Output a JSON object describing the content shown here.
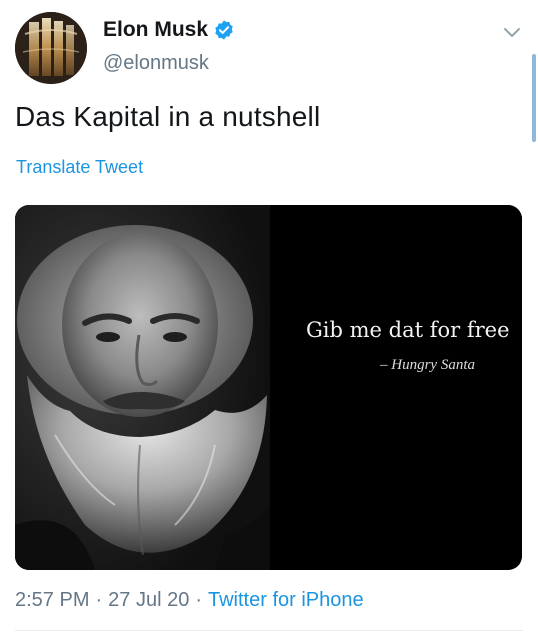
{
  "author": {
    "name": "Elon Musk",
    "handle": "@elonmusk",
    "verified": true,
    "avatar_icon": "profile-avatar"
  },
  "tweet": {
    "text": "Das Kapital in a nutshell",
    "translate_label": "Translate Tweet"
  },
  "media": {
    "quote": "Gib me dat for free",
    "attribution": "– Hungry Santa",
    "portrait_icon": "bearded-man-portrait"
  },
  "meta": {
    "time": "2:57 PM",
    "separator": "·",
    "date": "27 Jul 20",
    "source": "Twitter for iPhone"
  },
  "icons": {
    "verified": "verified-badge-icon",
    "menu": "chevron-down-icon"
  },
  "colors": {
    "link": "#1b95e0",
    "verified": "#1da1f2",
    "secondary_text": "#657786",
    "primary_text": "#14171a"
  }
}
